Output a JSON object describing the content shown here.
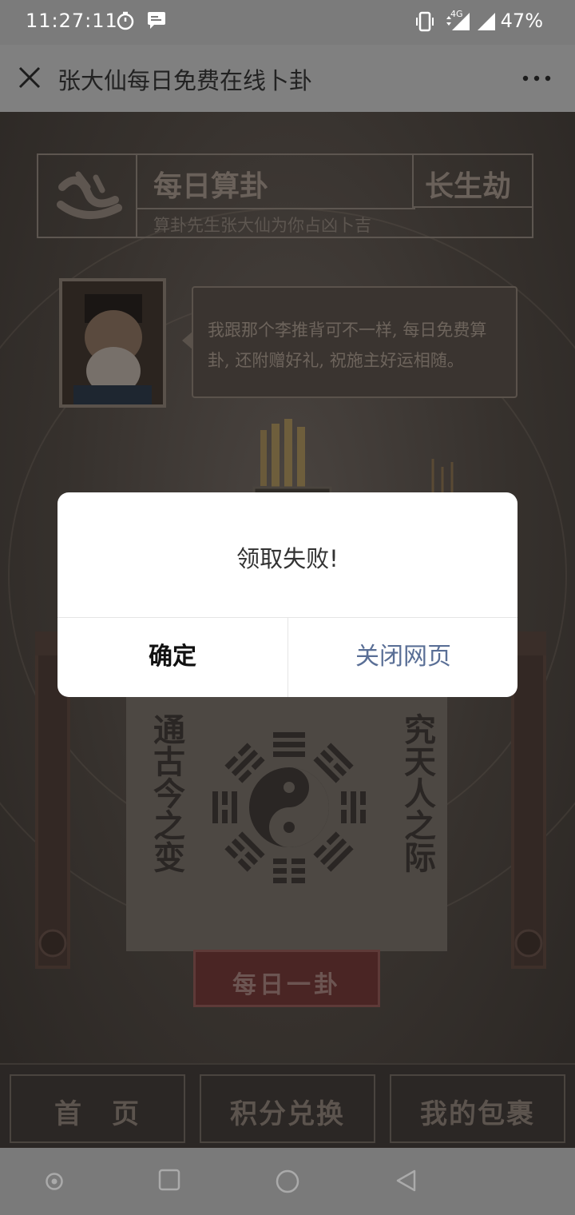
{
  "status_bar": {
    "time": "11:27:11",
    "network": "4G",
    "battery": "47%"
  },
  "title_bar": {
    "title": "张大仙每日免费在线卜卦"
  },
  "page": {
    "header_title": "每日算卦",
    "header_right": "长生劫",
    "header_subtitle": "算卦先生张大仙为你占凶卜吉",
    "speech": "我跟那个李推背可不一样, 每日免费算卦, 还附赠好礼, 祝施主好运相随。",
    "scroll_left": "通古今之变",
    "scroll_right": "究天人之际",
    "daily_button": "每日一卦",
    "nav": [
      "首　页",
      "积分兑换",
      "我的包裹"
    ]
  },
  "dialog": {
    "message": "领取失败!",
    "confirm": "确定",
    "close": "关闭网页"
  },
  "colors": {
    "status_bar_bg": "#7b7b7b",
    "dialog_close_text": "#5a6f96"
  }
}
